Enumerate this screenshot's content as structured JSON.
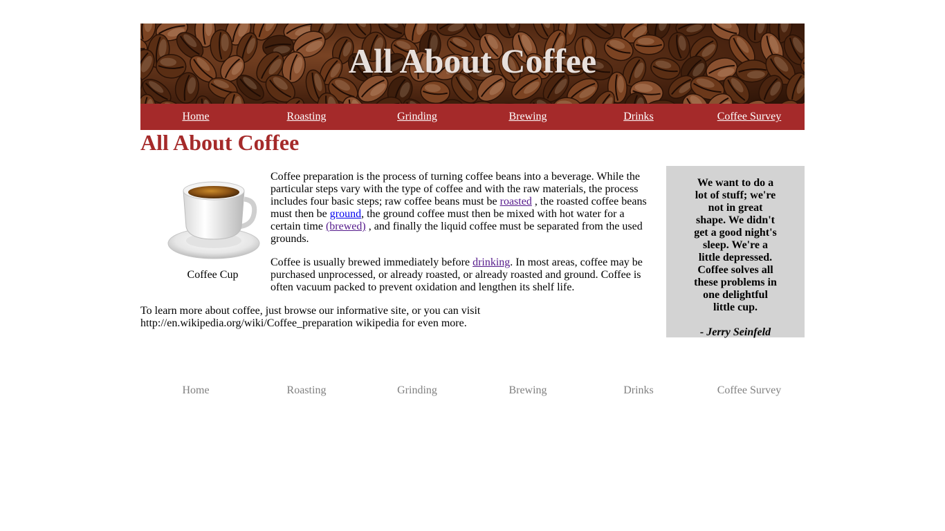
{
  "header": {
    "title": "All About Coffee"
  },
  "nav": {
    "items": [
      {
        "label": "Home"
      },
      {
        "label": "Roasting"
      },
      {
        "label": "Grinding"
      },
      {
        "label": "Brewing"
      },
      {
        "label": "Drinks"
      },
      {
        "label": "Coffee Survey"
      }
    ]
  },
  "main": {
    "heading": "All About Coffee",
    "figure_caption": "Coffee Cup",
    "paragraph1": {
      "part1": "Coffee preparation is the process of turning coffee beans into a beverage. While the particular steps vary with the type of coffee and with the raw materials, the process includes four basic steps; raw coffee beans must be ",
      "link_roasted": "roasted",
      "part2": " , the roasted coffee beans must then be ",
      "link_ground": "ground",
      "part3": ", the ground coffee must then be mixed with hot water for a certain time ",
      "link_brewed": "(brewed)",
      "part4": " , and finally the liquid coffee must be separated from the used grounds."
    },
    "paragraph2": {
      "part1": "Coffee is usually brewed immediately before ",
      "link_drinking": "drinking",
      "part2": ". In most areas, coffee may be purchased unprocessed, or already roasted, or already roasted and ground. Coffee is often vacuum packed to prevent oxidation and lengthen its shelf life."
    },
    "learn_more": "To learn more about coffee, just browse our informative site, or you can visit http://en.wikipedia.org/wiki/Coffee_preparation wikipedia for even more."
  },
  "quote": {
    "text": "We want to do a lot of stuff; we're not in great shape. We didn't get a good night's sleep. We're a little depressed. Coffee solves all these problems in one delightful little cup.",
    "attribution": "- Jerry Seinfeld"
  },
  "colors": {
    "accent": "#a52a2a",
    "quote_bg": "#d3d3d3",
    "footer_link": "#808080"
  },
  "icons": {
    "banner": "coffee-beans-image",
    "figure": "coffee-cup-image"
  }
}
